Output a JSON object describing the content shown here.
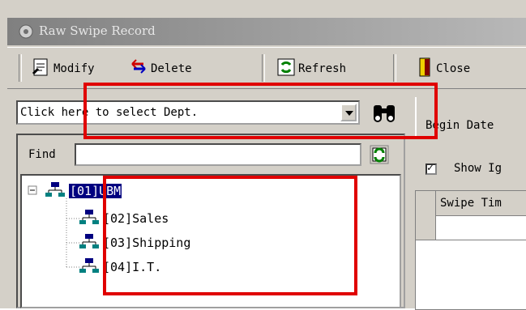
{
  "window": {
    "title": "Raw Swipe Record"
  },
  "toolbar": {
    "modify_label": "Modify",
    "delete_label": "Delete",
    "refresh_label": "Refresh",
    "close_label": "Close"
  },
  "dept_select": {
    "value": "Click here to select Dept."
  },
  "find": {
    "label": "Find",
    "value": ""
  },
  "tree": {
    "root": "[01]UBM",
    "children": [
      "[02]Sales",
      "[03]Shipping",
      "[04]I.T."
    ]
  },
  "right": {
    "begin_date_label": "Begin Date",
    "show_ignored_label": "Show Ig",
    "grid_header": "Swipe Tim"
  },
  "colors": {
    "selection": "#000080",
    "highlight_box": "#e00000"
  }
}
